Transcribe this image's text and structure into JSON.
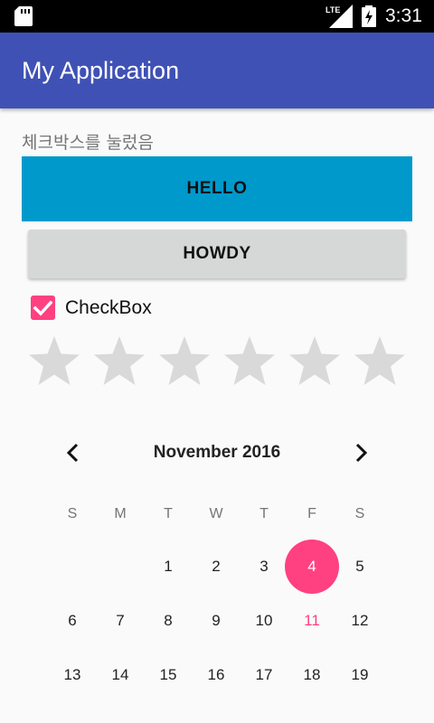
{
  "status_bar": {
    "time": "3:31",
    "network_label": "LTE",
    "icons": [
      "sd-card-icon",
      "lte-signal-icon",
      "battery-charging-icon"
    ]
  },
  "app_bar": {
    "title": "My Application",
    "color": "#3f51b5"
  },
  "content": {
    "message": "체크박스를 눌렀음",
    "hello_button": "HELLO",
    "howdy_button": "HOWDY",
    "checkbox": {
      "label": "CheckBox",
      "checked": true,
      "accent": "#ff4081"
    },
    "rating": {
      "stars": 6,
      "value": 0,
      "empty_color": "#d9d9d9"
    }
  },
  "calendar": {
    "month_label": "November 2016",
    "prev_icon": "chevron-left-icon",
    "next_icon": "chevron-right-icon",
    "weekdays": [
      "S",
      "M",
      "T",
      "W",
      "T",
      "F",
      "S"
    ],
    "weeks": [
      [
        "",
        "",
        "1",
        "2",
        "3",
        "4",
        "5"
      ],
      [
        "6",
        "7",
        "8",
        "9",
        "10",
        "11",
        "12"
      ],
      [
        "13",
        "14",
        "15",
        "16",
        "17",
        "18",
        "19"
      ]
    ],
    "selected_day": "4",
    "today": "11",
    "accent": "#ff4081"
  }
}
